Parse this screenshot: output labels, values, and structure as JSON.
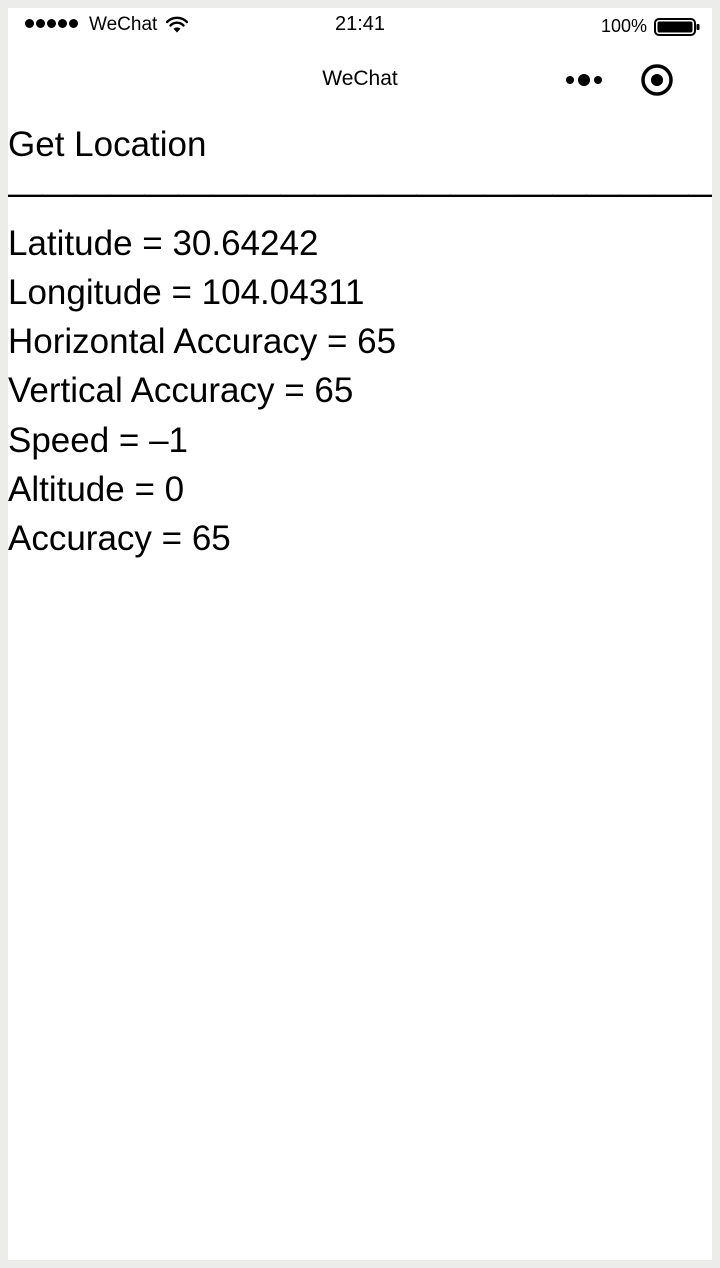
{
  "status_bar": {
    "carrier": "WeChat",
    "time": "21:41",
    "battery_percent": "100%"
  },
  "nav_bar": {
    "title": "WeChat",
    "more_icon": "more-dots-icon",
    "close_icon": "target-close-icon"
  },
  "page": {
    "heading": "Get Location",
    "divider": "——————————————————————",
    "lines": [
      "Latitude = 30.64242",
      "Longitude = 104.04311",
      "Horizontal Accuracy = 65",
      "Vertical Accuracy = 65",
      "Speed = –1",
      "Altitude = 0",
      "Accuracy = 65"
    ]
  }
}
